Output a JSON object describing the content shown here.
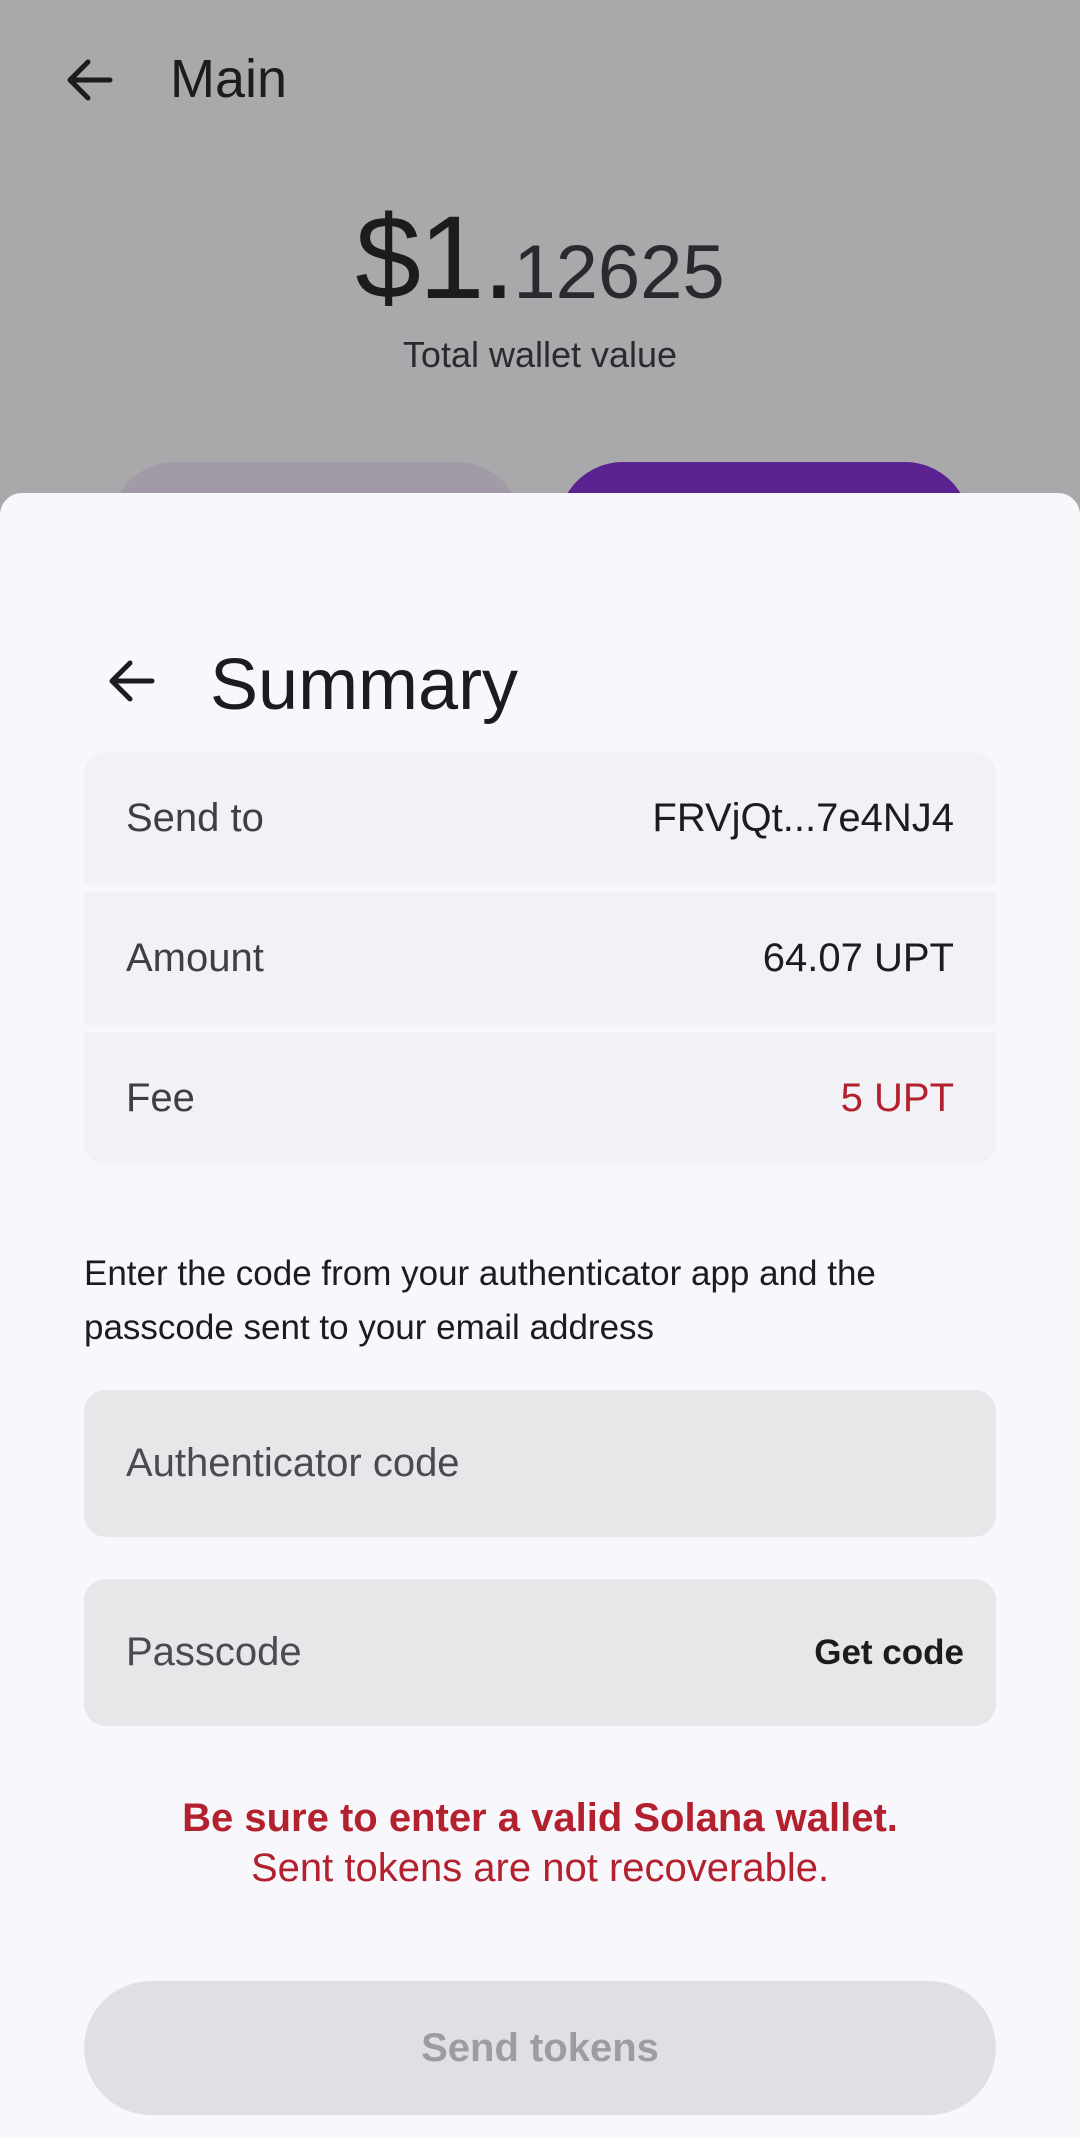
{
  "background": {
    "title": "Main",
    "balance_whole": "$1.",
    "balance_decimals": "12625",
    "balance_label": "Total wallet value"
  },
  "summary": {
    "title": "Summary",
    "rows": [
      {
        "label": "Send to",
        "value": "FRVjQt...7e4NJ4"
      },
      {
        "label": "Amount",
        "value": "64.07 UPT"
      },
      {
        "label": "Fee",
        "value": "5 UPT"
      }
    ]
  },
  "instructions": "Enter the code from your authenticator app and the passcode sent to your email address",
  "fields": {
    "authenticator_placeholder": "Authenticator code",
    "passcode_placeholder": "Passcode",
    "get_code_label": "Get code"
  },
  "warning": {
    "line1": "Be sure to enter a valid Solana wallet.",
    "line2": "Sent tokens are not recoverable."
  },
  "send_button_label": "Send tokens",
  "colors": {
    "accent": "#5a2391",
    "warning": "#b3212f",
    "disabled_button": "#e0e0e4"
  },
  "icons": {
    "back": "arrow-left-icon"
  }
}
